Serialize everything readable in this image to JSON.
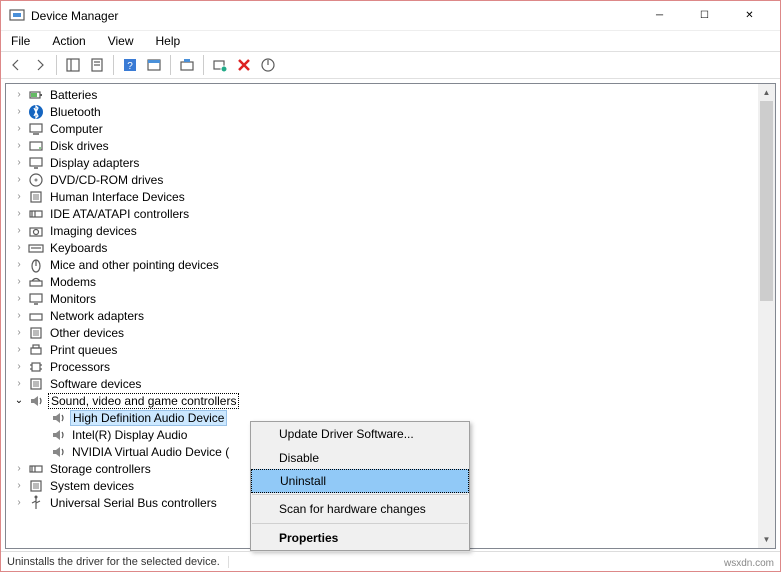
{
  "window": {
    "title": "Device Manager",
    "watermark": "wsxdn.com"
  },
  "menubar": [
    "File",
    "Action",
    "View",
    "Help"
  ],
  "toolbar_icons": [
    "back-icon",
    "forward-icon",
    "",
    "show-hide-tree-icon",
    "properties-icon",
    "",
    "help-icon",
    "print-icon",
    "",
    "update-driver-icon",
    "",
    "scan-icon",
    "uninstall-icon",
    "disable-icon"
  ],
  "tree": [
    {
      "label": "Batteries",
      "icon": "battery-icon",
      "expandable": true
    },
    {
      "label": "Bluetooth",
      "icon": "bluetooth-icon",
      "expandable": true
    },
    {
      "label": "Computer",
      "icon": "computer-icon",
      "expandable": true
    },
    {
      "label": "Disk drives",
      "icon": "disk-icon",
      "expandable": true
    },
    {
      "label": "Display adapters",
      "icon": "display-icon",
      "expandable": true
    },
    {
      "label": "DVD/CD-ROM drives",
      "icon": "dvd-icon",
      "expandable": true
    },
    {
      "label": "Human Interface Devices",
      "icon": "hid-icon",
      "expandable": true
    },
    {
      "label": "IDE ATA/ATAPI controllers",
      "icon": "ide-icon",
      "expandable": true
    },
    {
      "label": "Imaging devices",
      "icon": "imaging-icon",
      "expandable": true
    },
    {
      "label": "Keyboards",
      "icon": "keyboard-icon",
      "expandable": true
    },
    {
      "label": "Mice and other pointing devices",
      "icon": "mouse-icon",
      "expandable": true
    },
    {
      "label": "Modems",
      "icon": "modem-icon",
      "expandable": true
    },
    {
      "label": "Monitors",
      "icon": "monitor-icon",
      "expandable": true
    },
    {
      "label": "Network adapters",
      "icon": "network-icon",
      "expandable": true
    },
    {
      "label": "Other devices",
      "icon": "other-icon",
      "expandable": true
    },
    {
      "label": "Print queues",
      "icon": "printer-icon",
      "expandable": true
    },
    {
      "label": "Processors",
      "icon": "cpu-icon",
      "expandable": true
    },
    {
      "label": "Software devices",
      "icon": "software-icon",
      "expandable": true
    },
    {
      "label": "Sound, video and game controllers",
      "icon": "sound-icon",
      "expandable": true,
      "expanded": true,
      "boxed": true,
      "children": [
        {
          "label": "High Definition Audio Device",
          "icon": "speaker-icon",
          "selected": true
        },
        {
          "label": "Intel(R) Display Audio",
          "icon": "speaker-icon"
        },
        {
          "label": "NVIDIA Virtual Audio Device (",
          "icon": "speaker-icon"
        }
      ]
    },
    {
      "label": "Storage controllers",
      "icon": "storage-icon",
      "expandable": true
    },
    {
      "label": "System devices",
      "icon": "system-icon",
      "expandable": true
    },
    {
      "label": "Universal Serial Bus controllers",
      "icon": "usb-icon",
      "expandable": true
    }
  ],
  "context_menu": {
    "items": [
      {
        "label": "Update Driver Software...",
        "key": "update"
      },
      {
        "label": "Disable",
        "key": "disable"
      },
      {
        "label": "Uninstall",
        "key": "uninstall",
        "highlighted": true
      },
      {
        "sep": true
      },
      {
        "label": "Scan for hardware changes",
        "key": "scan"
      },
      {
        "sep": true
      },
      {
        "label": "Properties",
        "key": "properties",
        "bold": true
      }
    ]
  },
  "statusbar": {
    "text": "Uninstalls the driver for the selected device."
  }
}
